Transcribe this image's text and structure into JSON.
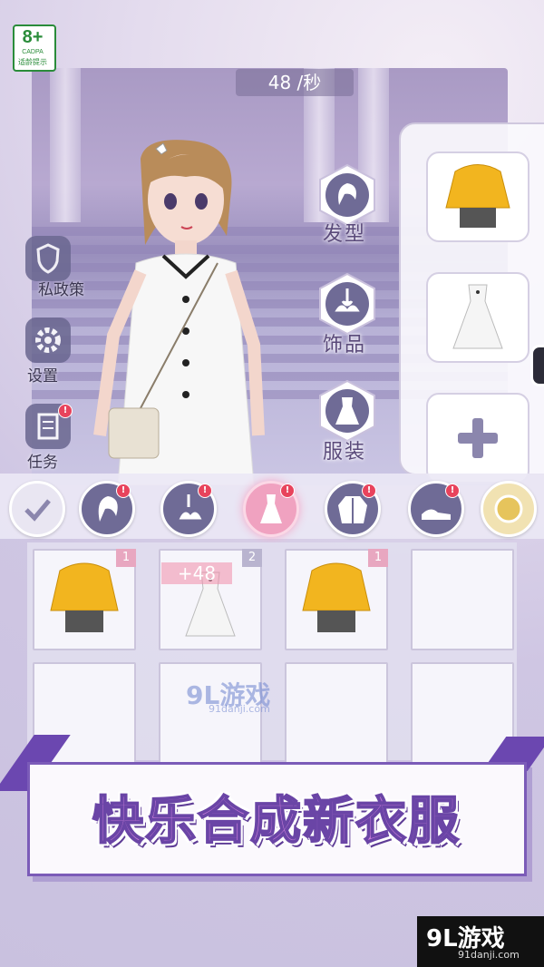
{
  "age_rating": {
    "number": "8+",
    "org": "CADPA",
    "caption": "适龄提示"
  },
  "timer": {
    "value": "48 /秒"
  },
  "side_menu": [
    {
      "label": "私政策",
      "icon": "shield-icon"
    },
    {
      "label": "设置",
      "icon": "gear-icon"
    },
    {
      "label": "任务",
      "icon": "task-icon",
      "badge": "!"
    }
  ],
  "categories": [
    {
      "label": "发型",
      "icon": "hair-icon"
    },
    {
      "label": "饰品",
      "icon": "accessory-icon"
    },
    {
      "label": "服装",
      "icon": "dress-icon"
    }
  ],
  "right_panel": [
    {
      "item": "yellow-hoodie-outfit"
    },
    {
      "item": "white-dress"
    },
    {
      "item": "add-slot",
      "symbol": "+"
    }
  ],
  "tabs": [
    {
      "name": "confirm",
      "icon": "check-icon"
    },
    {
      "name": "hair",
      "icon": "hair-icon",
      "badge": "!"
    },
    {
      "name": "accessory",
      "icon": "accessory-icon",
      "badge": "!"
    },
    {
      "name": "dress",
      "icon": "dress-icon",
      "badge": "!",
      "active": true
    },
    {
      "name": "coat",
      "icon": "coat-icon",
      "badge": "!"
    },
    {
      "name": "shoes",
      "icon": "shoes-icon",
      "badge": "!"
    },
    {
      "name": "more",
      "icon": "coin-icon"
    }
  ],
  "inventory": [
    {
      "item": "yellow-hoodie-outfit",
      "level": "1"
    },
    {
      "item": "white-dress",
      "level": "2"
    },
    {
      "item": "yellow-hoodie-outfit",
      "level": "1"
    },
    {
      "item": "empty"
    },
    {
      "item": "empty"
    },
    {
      "item": "empty"
    },
    {
      "item": "empty"
    },
    {
      "item": "empty"
    }
  ],
  "bonus_popup": "+48",
  "watermark": {
    "text": "9L游戏",
    "sub": "91danji.com"
  },
  "banner": {
    "text": "快乐合成新衣服"
  },
  "site_logo": {
    "text": "9L游戏",
    "sub": "91danji.com"
  },
  "colors": {
    "accent": "#7b5bb8",
    "active_tab": "#f0a2c0",
    "badge": "#e8435c",
    "banner_text": "#c77bd8"
  }
}
